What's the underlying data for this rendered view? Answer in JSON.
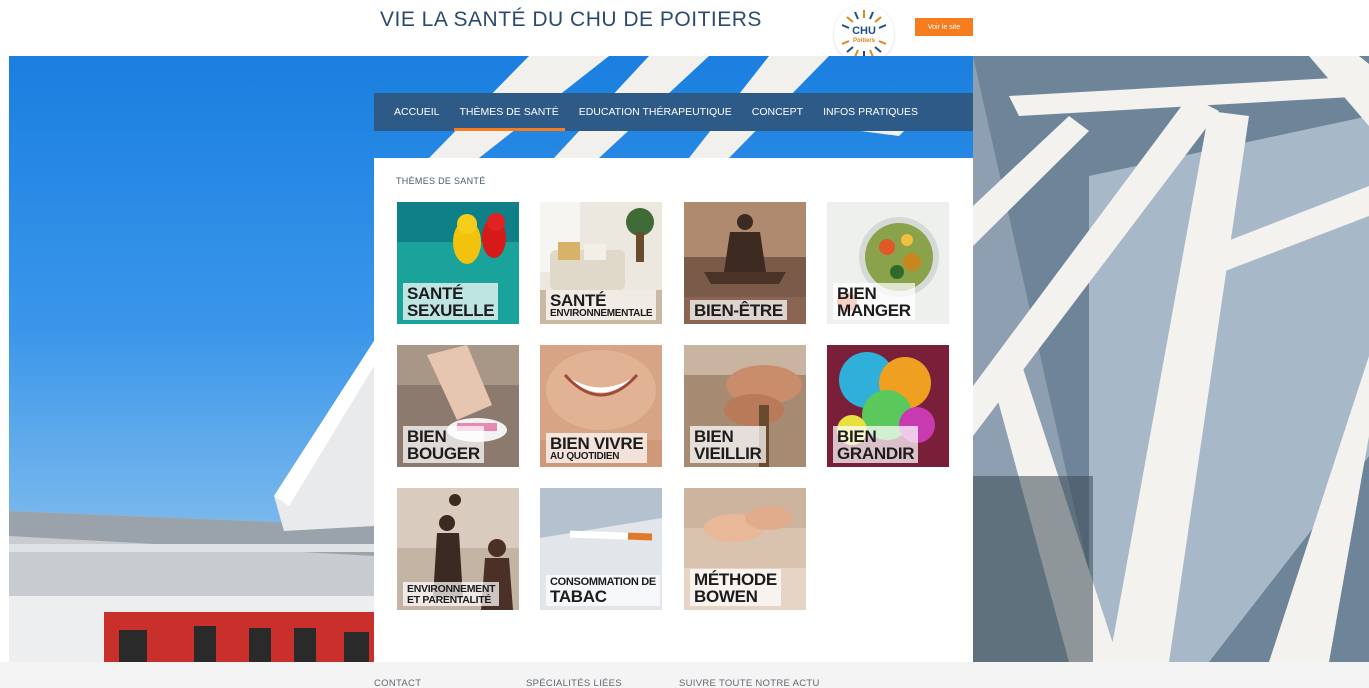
{
  "header": {
    "title": "VIE LA SANTÉ DU CHU DE POITIERS",
    "logo_chu": "CHU",
    "logo_city": "Poitiers",
    "visit_button": "Voir le site"
  },
  "nav": {
    "items": [
      {
        "label": "ACCUEIL"
      },
      {
        "label": "THÈMES DE SANTÉ",
        "active": true
      },
      {
        "label": "EDUCATION THÉRAPEUTIQUE"
      },
      {
        "label": "CONCEPT"
      },
      {
        "label": "INFOS PRATIQUES"
      }
    ]
  },
  "main": {
    "section_title": "THÈMES DE SANTÉ",
    "tiles": [
      {
        "line1": "SANTÉ",
        "line2": "SEXUELLE"
      },
      {
        "line1": "SANTÉ",
        "line2": "ENVIRONNEMENTALE"
      },
      {
        "line1": "BIEN-ÊTRE"
      },
      {
        "line1": "BIEN",
        "line2": "MANGER"
      },
      {
        "line1": "BIEN",
        "line2": "BOUGER"
      },
      {
        "line1": "BIEN VIVRE",
        "line2": "AU QUOTIDIEN"
      },
      {
        "line1": "BIEN",
        "line2": "VIEILLIR"
      },
      {
        "line1": "BIEN",
        "line2": "GRANDIR"
      },
      {
        "line1": "ENVIRONNEMENT",
        "line2": "ET PARENTALITÉ"
      },
      {
        "line1": "CONSOMMATION DE",
        "line2": "TABAC"
      },
      {
        "line1": "MÉTHODE",
        "line2": "BOWEN"
      }
    ]
  },
  "footer": {
    "links": [
      "CONTACT",
      "SPÉCIALITÉS LIÉES",
      "SUIVRE TOUTE NOTRE ACTU"
    ]
  },
  "colors": {
    "accent": "#f57c1f",
    "nav": "#2d5a86",
    "title": "#2d4a6e"
  }
}
